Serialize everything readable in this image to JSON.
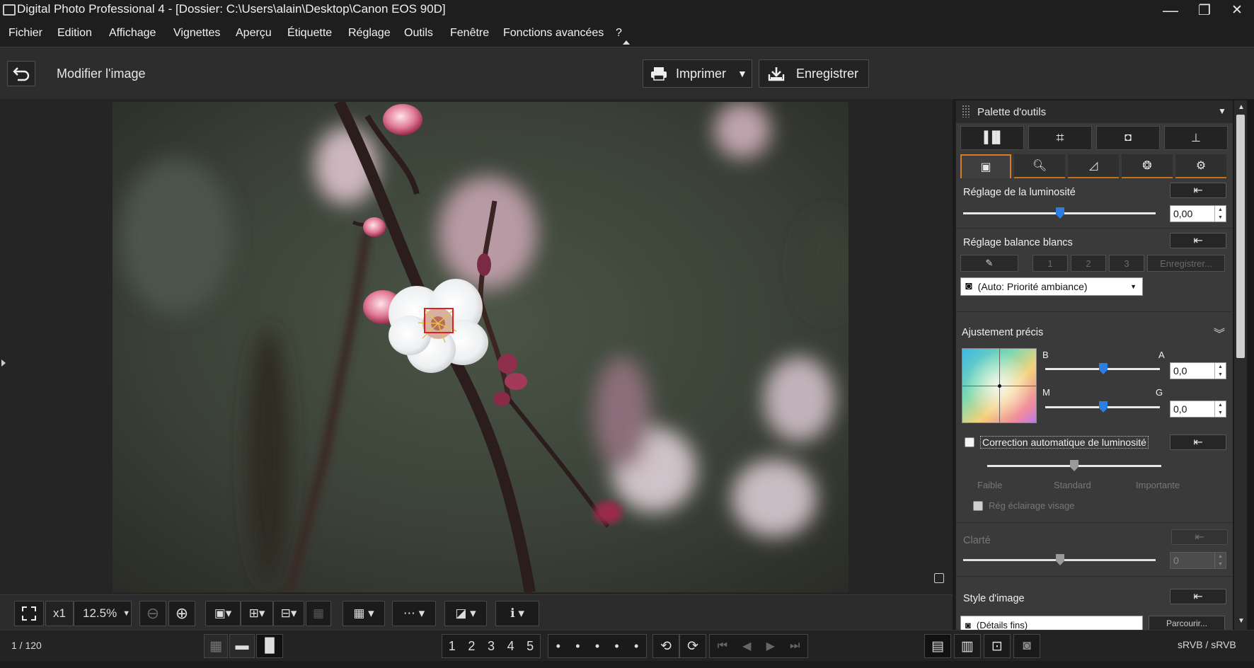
{
  "window": {
    "title": "Digital Photo Professional 4 - [Dossier: C:\\Users\\alain\\Desktop\\Canon EOS 90D]",
    "minimize": "—",
    "maximize": "❐",
    "close": "✕"
  },
  "menu": {
    "items": [
      "Fichier",
      "Edition",
      "Affichage",
      "Vignettes",
      "Aperçu",
      "Étiquette",
      "Réglage",
      "Outils",
      "Fenêtre",
      "Fonctions avancées",
      "?"
    ]
  },
  "toolbar": {
    "back_icon": "undo-arrow-icon",
    "title": "Modifier l'image",
    "print_label": "Imprimer",
    "save_label": "Enregistrer"
  },
  "viewbar": {
    "fit_icon": "fit-screen-icon",
    "x1_label": "x1",
    "zoom_value": "12.5%",
    "zoom_out_icon": "zoom-out-icon",
    "zoom_in_icon": "zoom-in-icon"
  },
  "statusbar": {
    "counter": "1 / 120",
    "ratings": [
      "1",
      "2",
      "3",
      "4",
      "5"
    ],
    "dots": [
      "•",
      "•",
      "•",
      "•",
      "•"
    ],
    "color_space": "sRVB / sRVB"
  },
  "palette": {
    "title": "Palette d'outils",
    "brightness": {
      "label": "Réglage de la luminosité",
      "value": "0,00",
      "level": 0.5
    },
    "white_balance": {
      "label": "Réglage balance blancs",
      "slots": [
        "1",
        "2",
        "3"
      ],
      "register_label": "Enregistrer...",
      "preset": "(Auto: Priorité ambiance)"
    },
    "fine_tune": {
      "label": "Ajustement précis",
      "b_label": "B",
      "a_label": "A",
      "m_label": "M",
      "g_label": "G",
      "ba_value": "0,0",
      "mg_value": "0,0"
    },
    "auto_lighting": {
      "label": "Correction automatique de luminosité",
      "levels": [
        "Faible",
        "Standard",
        "Importante"
      ],
      "face_label": "Rég éclairage visage"
    },
    "clarity": {
      "label": "Clarté",
      "value": "0"
    },
    "picture_style": {
      "label": "Style d'image",
      "value": "(Détails fins)",
      "browse_label": "Parcourir..."
    }
  },
  "colors": {
    "accent_orange": "#d17e24",
    "slider_blue": "#2b7fe0",
    "af_frame_red": "#e02020"
  }
}
